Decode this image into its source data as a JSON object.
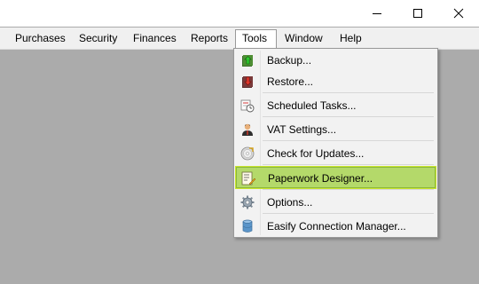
{
  "window": {
    "minimize_icon": "minimize-icon",
    "maximize_icon": "maximize-icon",
    "close_icon": "close-icon"
  },
  "menubar": {
    "items": [
      "Purchases",
      "Security",
      "Finances",
      "Reports",
      "Tools",
      "Window",
      "Help"
    ],
    "open_item": "Tools"
  },
  "tools_menu": {
    "items": [
      {
        "label": "Backup...",
        "icon": "backup-icon"
      },
      {
        "label": "Restore...",
        "icon": "restore-icon"
      },
      {
        "label": "Scheduled Tasks...",
        "icon": "scheduled-tasks-icon"
      },
      {
        "label": "VAT Settings...",
        "icon": "vat-settings-icon"
      },
      {
        "label": "Check for Updates...",
        "icon": "check-updates-icon"
      },
      {
        "label": "Paperwork Designer...",
        "icon": "paperwork-designer-icon"
      },
      {
        "label": "Options...",
        "icon": "options-gear-icon"
      },
      {
        "label": "Easify Connection Manager...",
        "icon": "connection-manager-icon"
      }
    ],
    "highlighted": "Paperwork Designer...",
    "highlight_color": "#b4d96a"
  }
}
